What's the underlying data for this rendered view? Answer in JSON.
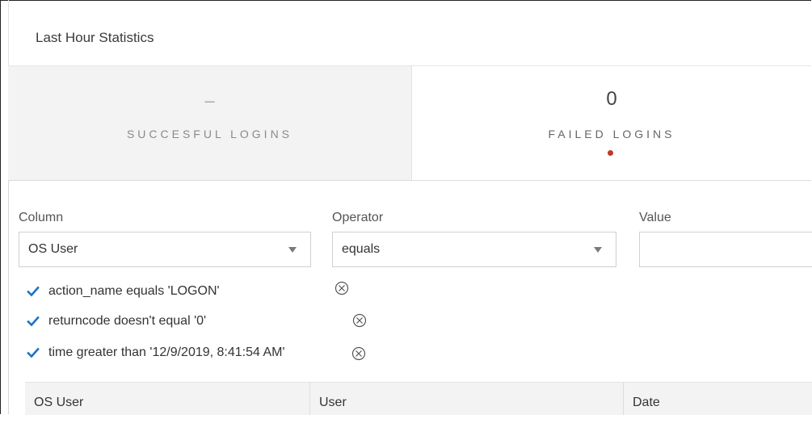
{
  "panel": {
    "title": "Last Hour Statistics"
  },
  "stats": {
    "successful": {
      "value": "–",
      "label": "SUCCESFUL LOGINS"
    },
    "failed": {
      "value": "0",
      "label": "FAILED LOGINS",
      "indicator_color": "#c0392b"
    }
  },
  "filter": {
    "column": {
      "label": "Column",
      "selected": "OS User"
    },
    "operator": {
      "label": "Operator",
      "selected": "equals"
    },
    "value": {
      "label": "Value",
      "current": ""
    }
  },
  "conditions": [
    {
      "text": "action_name equals 'LOGON'",
      "checked": true,
      "remove_icon": "circle-x-icon"
    },
    {
      "text": "returncode doesn't equal '0'",
      "checked": true,
      "remove_icon": "circle-x-icon"
    },
    {
      "text": "time greater than '12/9/2019, 8:41:54 AM'",
      "checked": true,
      "remove_icon": "circle-x-icon"
    }
  ],
  "table": {
    "columns": [
      "OS User",
      "User",
      "Date"
    ]
  },
  "colors": {
    "accent": "#1a73c8",
    "failed_dot": "#c0392b"
  }
}
